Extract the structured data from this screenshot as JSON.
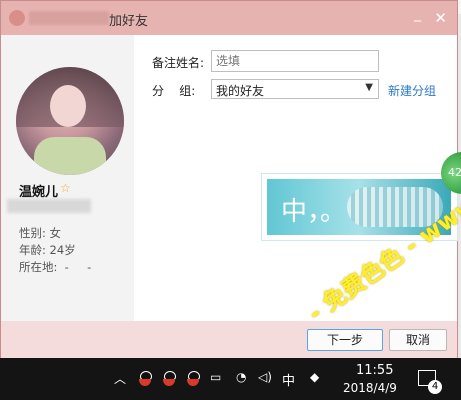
{
  "dialog": {
    "title": "加好友",
    "title_visible_suffix": "加好友"
  },
  "profile": {
    "nickname": "温婉儿",
    "gender": "性别: 女",
    "age": "年龄: 24岁",
    "location": "所在地:  -     -"
  },
  "form": {
    "remark_label": "备注姓名:",
    "remark_placeholder": "选填",
    "group_label": "分    组:",
    "group_value": "我的好友",
    "new_group_link": "新建分组"
  },
  "ad": {
    "text": "中，。"
  },
  "badge": {
    "count": "42"
  },
  "buttons": {
    "next": "下一步",
    "cancel": "取消"
  },
  "watermark": {
    "text": "- 免费色色 - www.MFsese.com"
  },
  "taskbar": {
    "ime": "中",
    "time": "11:55",
    "date": "2018/4/9",
    "notification_count": "4"
  },
  "colors": {
    "titlebar": "#e7b3b0",
    "link": "#2b79c9",
    "watermark": "#ffef2a",
    "taskbar": "#141414"
  }
}
